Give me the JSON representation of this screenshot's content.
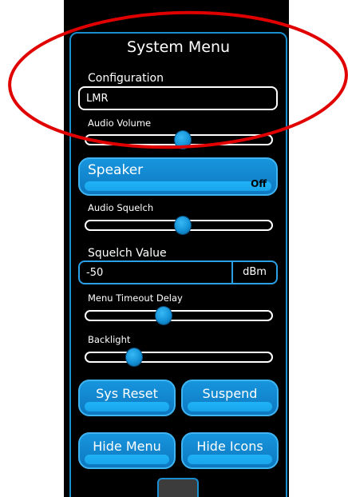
{
  "menu": {
    "title": "System Menu",
    "configuration": {
      "label": "Configuration",
      "value": "LMR"
    },
    "audio_volume": {
      "label": "Audio Volume",
      "level_fraction": 0.52
    },
    "speaker": {
      "label": "Speaker",
      "state": "Off"
    },
    "audio_squelch": {
      "label": "Audio Squelch",
      "level_fraction": 0.52
    },
    "squelch_value": {
      "label": "Squelch Value",
      "value": "-50",
      "unit": "dBm"
    },
    "menu_timeout": {
      "label": "Menu Timeout Delay",
      "level_fraction": 0.42
    },
    "backlight": {
      "label": "Backlight",
      "level_fraction": 0.26
    },
    "buttons": {
      "sys_reset": "Sys Reset",
      "suspend": "Suspend",
      "hide_menu": "Hide Menu",
      "hide_icons": "Hide Icons"
    }
  },
  "colors": {
    "background": "#000000",
    "accent": "#1a8fd0",
    "button": "#1795dd",
    "annotation": "#e00000"
  }
}
